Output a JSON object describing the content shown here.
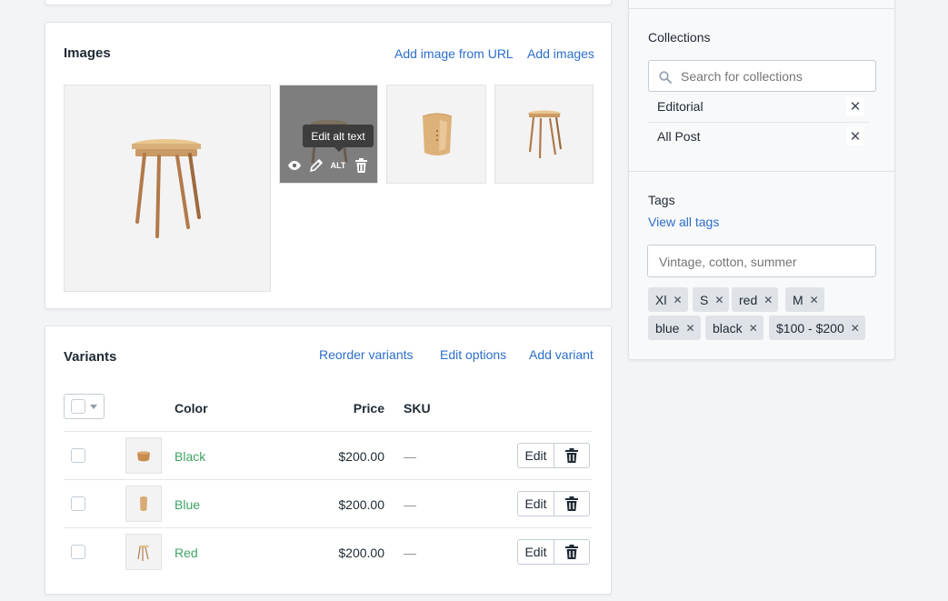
{
  "images": {
    "title": "Images",
    "add_from_url": "Add image from URL",
    "add_images": "Add images",
    "tooltip": "Edit alt text",
    "alt_label": "ALT"
  },
  "variants": {
    "title": "Variants",
    "reorder": "Reorder variants",
    "edit_options": "Edit options",
    "add_variant": "Add variant",
    "columns": {
      "color": "Color",
      "price": "Price",
      "sku": "SKU"
    },
    "edit_label": "Edit",
    "rows": [
      {
        "name": "Black",
        "price": "$200.00",
        "sku": "—"
      },
      {
        "name": "Blue",
        "price": "$200.00",
        "sku": "—"
      },
      {
        "name": "Red",
        "price": "$200.00",
        "sku": "—"
      }
    ]
  },
  "sidebar": {
    "collections": {
      "label": "Collections",
      "search_placeholder": "Search for collections",
      "items": [
        "Editorial",
        "All Post"
      ]
    },
    "tags": {
      "label": "Tags",
      "view_all": "View all tags",
      "input_placeholder": "Vintage, cotton, summer",
      "items": [
        "Xl",
        "S",
        "red",
        "M",
        "blue",
        "black",
        "$100 - $200"
      ]
    }
  },
  "colors": {
    "link": "#2c6ecb",
    "variant_link": "#3fa365",
    "border": "#dfe3e8",
    "background": "#f3f4f6"
  }
}
